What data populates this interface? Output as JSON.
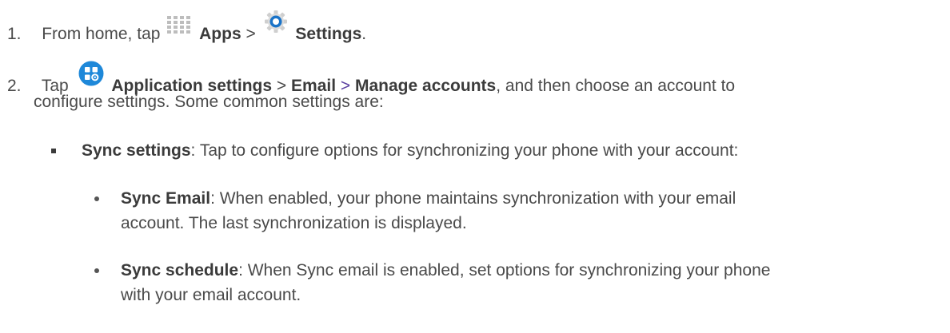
{
  "step1": {
    "number": "1.",
    "prefix": "From home, tap",
    "apps": "Apps",
    "sep": ">",
    "settings": "Settings",
    "end": "."
  },
  "step2": {
    "number": "2.",
    "tap": "Tap",
    "app_settings": "Application settings",
    "sep1": ">",
    "email": "Email",
    "sep2": ">",
    "manage": "Manage accounts",
    "line1_rest": ", and then choose an account to",
    "line2": "configure settings. Some common settings are:"
  },
  "sync_settings": {
    "label": "Sync settings",
    "text": ": Tap to configure options for synchronizing your phone with your account:"
  },
  "sync_email": {
    "label": "Sync Email",
    "text": ": When enabled, your phone maintains synchronization with your email",
    "line2": "account. The last synchronization is displayed."
  },
  "sync_schedule": {
    "label": "Sync schedule",
    "text": ": When Sync email is enabled, set options for synchronizing your phone",
    "line2": "with your email account."
  },
  "icons": {
    "apps": "apps-grid-icon",
    "settings": "settings-gear-icon",
    "application_settings": "application-settings-icon"
  },
  "colors": {
    "text": "#4a4a4a",
    "bold": "#3b3b3b",
    "separator_purple": "#5a3fa0",
    "settings_icon_blue": "#1a73c8",
    "appsettings_icon_blue": "#1e88d9"
  }
}
